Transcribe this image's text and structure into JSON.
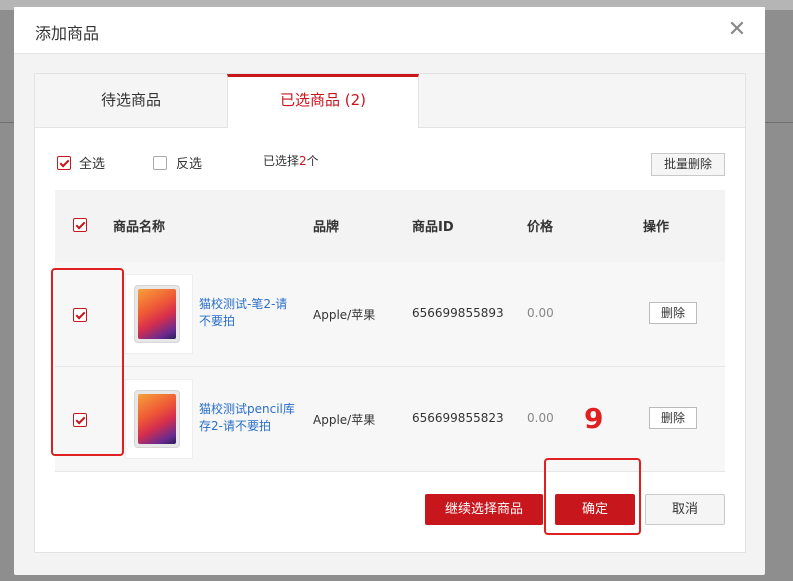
{
  "dialog": {
    "title": "添加商品",
    "close_icon": "close-icon"
  },
  "tabs": [
    {
      "label": "待选商品",
      "active": false
    },
    {
      "label": "已选商品 (2)",
      "active": true
    }
  ],
  "toolbar": {
    "select_all": {
      "label": "全选",
      "checked": true
    },
    "invert": {
      "label": "反选",
      "checked": false
    },
    "selected_prefix": "已选择",
    "selected_count": "2",
    "selected_suffix": "个",
    "batch_delete": "批量删除"
  },
  "table": {
    "columns": [
      "商品名称",
      "品牌",
      "商品ID",
      "价格",
      "操作"
    ],
    "header_checked": true,
    "rows": [
      {
        "checked": true,
        "name": "猫校测试-笔2-请不要拍",
        "brand": "Apple/苹果",
        "id": "656699855893",
        "price": "0.00",
        "action": "删除",
        "thumb_icon": "ipad-image"
      },
      {
        "checked": true,
        "name": "猫校测试pencil库存2-请不要拍",
        "brand": "Apple/苹果",
        "id": "656699855823",
        "price": "0.00",
        "action": "删除",
        "thumb_icon": "ipad-image"
      }
    ]
  },
  "footer": {
    "continue": "继续选择商品",
    "confirm": "确定",
    "cancel": "取消"
  },
  "annotation": {
    "step_number": "9",
    "color": "#e02020"
  },
  "colors": {
    "accent": "#c8161d",
    "link": "#2a6fc9"
  }
}
